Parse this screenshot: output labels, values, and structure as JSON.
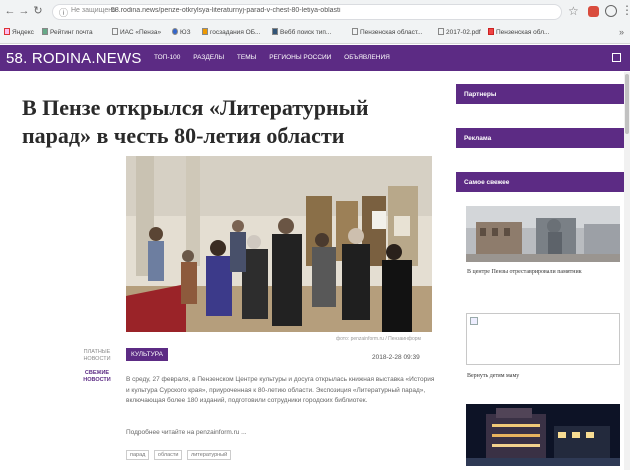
{
  "browser": {
    "back_icon": "arrow-left",
    "forward_icon": "arrow-right",
    "reload_icon": "reload",
    "url_note": "Не защищено",
    "url": "58.rodina.news/penze-otkrylsya-literaturnyj-parad-v-chest-80-letiya-oblasti",
    "bookmarks": [
      "Яндекс",
      "Рейтинг почта",
      "ИАС «Пенза»",
      "ЮЗ",
      "госзадания ОБ...",
      "Вебб поиск тип...",
      "Пензенская област...",
      "2017-02.pdf",
      "Пензенская обл..."
    ],
    "bookmarks_more": "»"
  },
  "site": {
    "logo": "58. RODINA.NEWS",
    "nav": [
      "ТОП-100",
      "РАЗДЕЛЫ",
      "ТЕМЫ",
      "РЕГИОНЫ РОССИИ",
      "ОБЪЯВЛЕНИЯ"
    ]
  },
  "article": {
    "title_line1": "В Пензе открылся «Литературный",
    "title_line2": "парад» в честь 80-летия области",
    "photo_credit": "фото: penzainform.ru / Пензаинформ",
    "left_category": "ПЛАТНЫЕ НОВОСТИ",
    "left_news": "СВЕЖИЕ НОВОСТИ",
    "tag": "КУЛЬТУРА",
    "date": "2018-2-28 09:39",
    "body": "В среду, 27 февраля, в Пензенском Центре культуры и досуга открылась книжная выставка «История и культура Сурского края», приуроченная к 80-летию области. Экспозиция «Литературный парад», включающая более 180 изданий, подготовили сотрудники городских библиотек.",
    "more": "Подробнее читайте на penzainform.ru ...",
    "hashtags": [
      "парад",
      "области",
      "литературный"
    ]
  },
  "sidebar": {
    "partners": "Партнеры",
    "ads": "Реклама",
    "freshest": "Самое свежее",
    "news1_caption": "В центре Пензы отреставрировали памятник",
    "news2_caption": "Вернуть детям маму"
  },
  "colors": {
    "brand": "#5c2b84",
    "background": "#ffffff",
    "text": "#2a2a2a"
  }
}
